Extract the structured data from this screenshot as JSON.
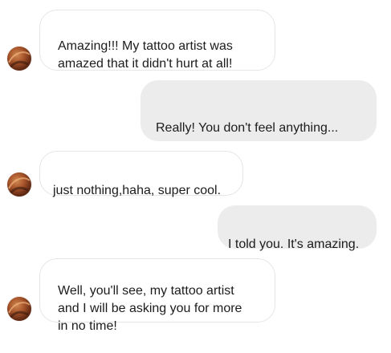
{
  "messages": [
    {
      "direction": "incoming",
      "text": "Amazing!!! My tattoo artist was\n amazed that it didn't hurt at all!",
      "avatar": "contact-avatar"
    },
    {
      "direction": "outgoing",
      "text": "Really! You don't feel anything..."
    },
    {
      "direction": "incoming",
      "text": "just nothing,haha, super cool.",
      "avatar": "contact-avatar"
    },
    {
      "direction": "outgoing",
      "text": "I told you. It's amazing."
    },
    {
      "direction": "incoming",
      "text": "Well, you'll see, my tattoo artist\nand I will be asking you for more\nin no time!",
      "avatar": "contact-avatar"
    }
  ],
  "colors": {
    "incoming_bg": "#ffffff",
    "incoming_border": "#e6e6e6",
    "outgoing_bg": "#ececec",
    "text": "#1c1c1c"
  }
}
